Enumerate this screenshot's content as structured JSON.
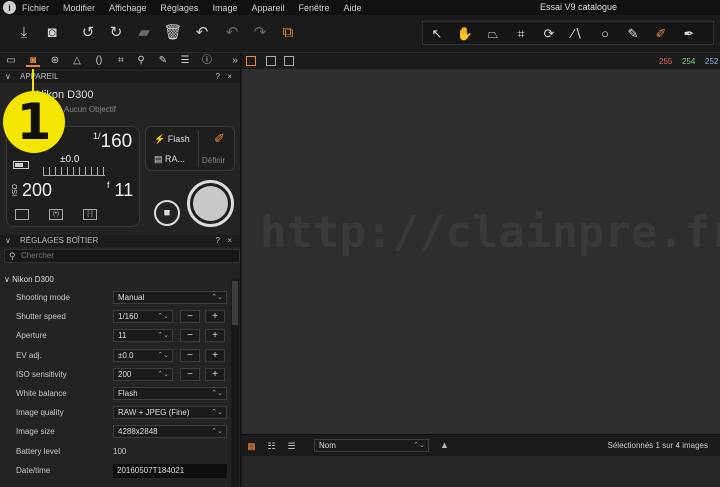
{
  "menu": {
    "items": [
      "Fichier",
      "Modifier",
      "Affichage",
      "Réglages",
      "Image",
      "Appareil",
      "Fenêtre",
      "Aide"
    ],
    "window_title": "Essai V9 catalogue"
  },
  "toolbar": {
    "left_icons": [
      "import-icon",
      "capture-icon",
      "undo-icon",
      "redo-icon",
      "move-to-folder-icon",
      "trash-icon",
      "reset-icon",
      "step-back-icon",
      "step-forward-icon",
      "variants-icon"
    ],
    "cursor_tools": [
      "select-icon",
      "pan-icon",
      "keystone-icon",
      "crop-icon",
      "rotate-icon",
      "straighten-icon",
      "spot-icon",
      "brush-icon",
      "picker-icon",
      "apply-icon"
    ]
  },
  "tool_tabs": [
    "folder-icon",
    "camera-icon",
    "color-icon",
    "exposure-icon",
    "lens-icon",
    "crop-icon",
    "search-icon",
    "adjust-icon",
    "meta-icon",
    "info-icon"
  ],
  "camera_section": {
    "header": "APPAREIL",
    "camera_name": "Nikon D300",
    "lens": "Aucun Objectif",
    "shutter_num": "1/",
    "shutter_den": "160",
    "ev": "±0.0",
    "iso_label": "ISO",
    "iso": "200",
    "aperture_prefix": "f",
    "aperture": "11",
    "flash_label": "Flash",
    "format_label": "RA...",
    "define_label": "Définir",
    "step_badge": "1"
  },
  "settings_section": {
    "header": "RÉGLAGES BOÎTIER",
    "search_placeholder": "Chercher",
    "group": "Nikon D300",
    "rows": [
      {
        "label": "Shooting mode",
        "value": "Manual"
      },
      {
        "label": "Shutter speed",
        "value": "1/160"
      },
      {
        "label": "Aperture",
        "value": "11"
      },
      {
        "label": "EV adj.",
        "value": "±0.0"
      },
      {
        "label": "ISO sensitivity",
        "value": "200"
      },
      {
        "label": "White balance",
        "value": "Flash"
      },
      {
        "label": "Image quality",
        "value": "RAW + JPEG (Fine)"
      },
      {
        "label": "Image size",
        "value": "4288x2848"
      },
      {
        "label": "Battery level",
        "value": "100"
      },
      {
        "label": "Date/time",
        "value": "20160507T184021"
      }
    ],
    "minus": "−",
    "plus": "+"
  },
  "viewer": {
    "rgb_r": "255",
    "rgb_g": "254",
    "rgb_b": "252",
    "watermark": "http://clainpre.free.fr",
    "colors": {
      "r": "#e06060",
      "g": "#7fd07f",
      "b": "#8aa8e8"
    }
  },
  "browser": {
    "sort_by": "Nom",
    "selection_status": "Sélectionnés 1 sur 4 images"
  }
}
